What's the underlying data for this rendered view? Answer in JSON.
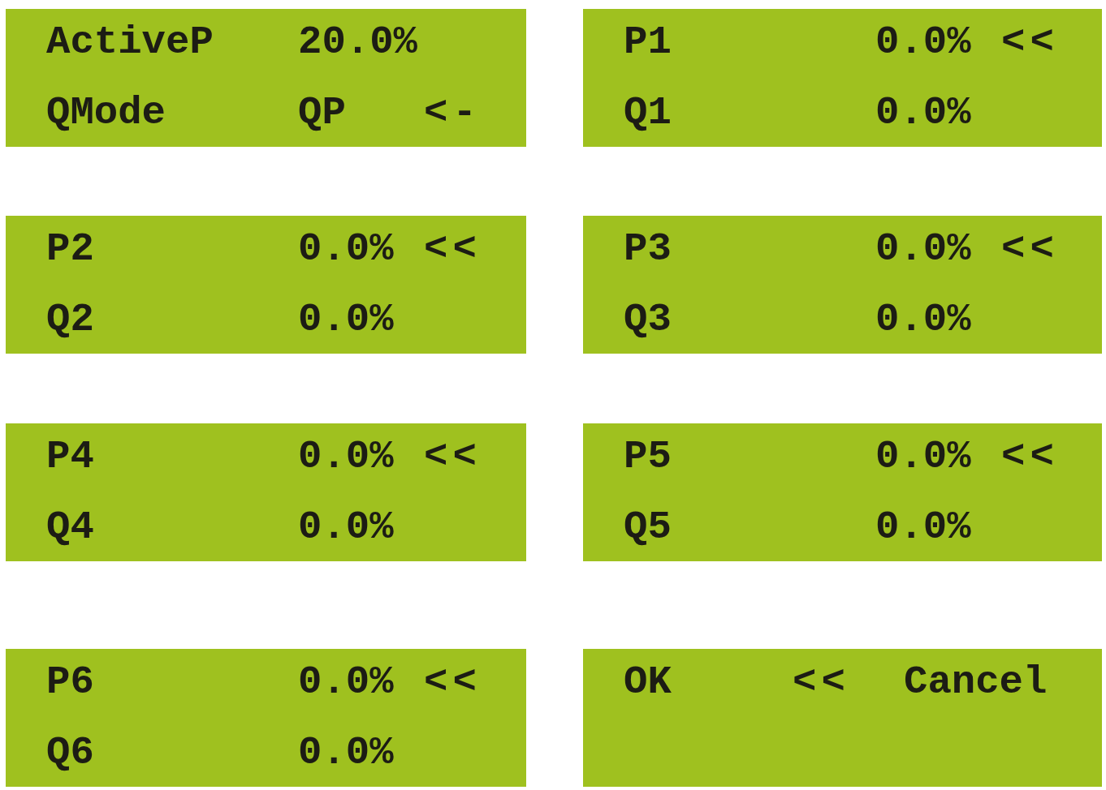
{
  "screens": [
    {
      "kind": "settings",
      "rows": [
        {
          "label": "ActiveP",
          "value": "20.0%"
        },
        {
          "label": "QMode",
          "value": "QP",
          "marker": "<-"
        }
      ]
    },
    {
      "kind": "settings",
      "rows": [
        {
          "label": "P1",
          "value": "0.0%",
          "marker": "<<"
        },
        {
          "label": "Q1",
          "value": "0.0%"
        }
      ]
    },
    {
      "kind": "settings",
      "rows": [
        {
          "label": "P2",
          "value": "0.0%",
          "marker": "<<"
        },
        {
          "label": "Q2",
          "value": "0.0%"
        }
      ]
    },
    {
      "kind": "settings",
      "rows": [
        {
          "label": "P3",
          "value": "0.0%",
          "marker": "<<"
        },
        {
          "label": "Q3",
          "value": "0.0%"
        }
      ]
    },
    {
      "kind": "settings",
      "rows": [
        {
          "label": "P4",
          "value": "0.0%",
          "marker": "<<"
        },
        {
          "label": "Q4",
          "value": "0.0%"
        }
      ]
    },
    {
      "kind": "settings",
      "rows": [
        {
          "label": "P5",
          "value": "0.0%",
          "marker": "<<"
        },
        {
          "label": "Q5",
          "value": "0.0%"
        }
      ]
    },
    {
      "kind": "settings",
      "rows": [
        {
          "label": "P6",
          "value": "0.0%",
          "marker": "<<"
        },
        {
          "label": "Q6",
          "value": "0.0%"
        }
      ]
    },
    {
      "kind": "confirm",
      "ok": "OK",
      "marker": "<<",
      "cancel": "Cancel"
    }
  ]
}
